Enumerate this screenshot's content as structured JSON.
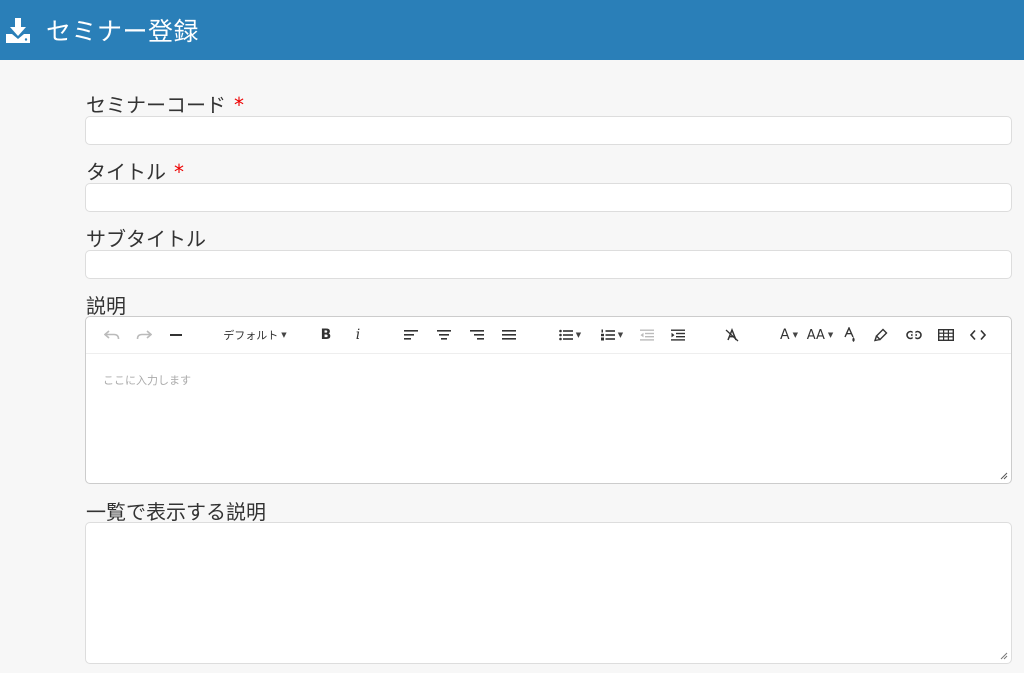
{
  "header": {
    "title": "セミナー登録",
    "icon": "download-icon",
    "color": "#2a7fb8"
  },
  "form": {
    "seminar_code": {
      "label": "セミナーコード",
      "required_mark": "*",
      "value": ""
    },
    "title": {
      "label": "タイトル",
      "required_mark": "*",
      "value": ""
    },
    "subtitle": {
      "label": "サブタイトル",
      "value": ""
    },
    "description": {
      "label": "説明",
      "placeholder": "ここに入力します",
      "toolbar": {
        "font_select": "デフォルト",
        "bold": "B",
        "italic": "i",
        "font_color": "A",
        "font_size": "AA"
      }
    },
    "list_description": {
      "label": "一覧で表示する説明",
      "value": ""
    }
  },
  "colors": {
    "required": "#ee0000",
    "placeholder": "#aaaaaa"
  }
}
